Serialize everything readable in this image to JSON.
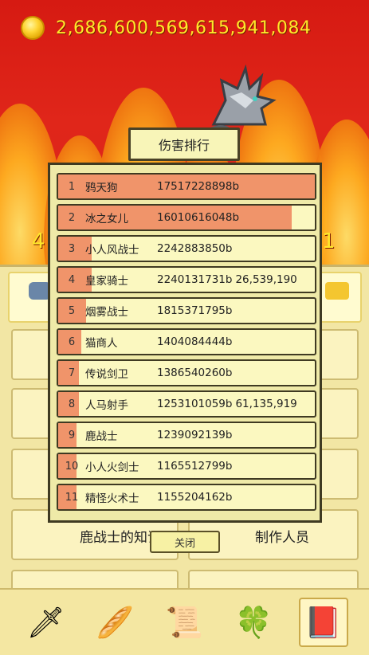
{
  "hud": {
    "coins": "2,686,600,569,615,941,084",
    "left_num": "4",
    "right_num": "1"
  },
  "dialog": {
    "title": "伤害排行",
    "close_label": "关闭",
    "rows": [
      {
        "rank": "1",
        "name": "鸦天狗",
        "damage": "17517228898b",
        "extra": "",
        "fill": 1.0
      },
      {
        "rank": "2",
        "name": "冰之女儿",
        "damage": "16010616048b",
        "extra": "",
        "fill": 0.91
      },
      {
        "rank": "3",
        "name": "小人风战士",
        "damage": "2242883850b",
        "extra": "",
        "fill": 0.13
      },
      {
        "rank": "4",
        "name": "皇家骑士",
        "damage": "2240131731b",
        "extra": "26,539,190",
        "fill": 0.13
      },
      {
        "rank": "5",
        "name": "烟雾战士",
        "damage": "1815371795b",
        "extra": "",
        "fill": 0.11
      },
      {
        "rank": "6",
        "name": "猫商人",
        "damage": "1404084444b",
        "extra": "",
        "fill": 0.09
      },
      {
        "rank": "7",
        "name": "传说剑卫",
        "damage": "1386540260b",
        "extra": "",
        "fill": 0.08
      },
      {
        "rank": "8",
        "name": "人马射手",
        "damage": "1253101059b",
        "extra": "61,135,919",
        "fill": 0.08
      },
      {
        "rank": "9",
        "name": "鹿战士",
        "damage": "1239092139b",
        "extra": "",
        "fill": 0.07
      },
      {
        "rank": "10",
        "name": "小人火剑士",
        "damage": "1165512799b",
        "extra": "",
        "fill": 0.07
      },
      {
        "rank": "11",
        "name": "精怪火术士",
        "damage": "1155204162b",
        "extra": "",
        "fill": 0.07
      }
    ]
  },
  "menu": {
    "item_knowledge": "鹿战士的知识",
    "item_credits": "制作人员"
  },
  "tabs": [
    {
      "name": "sword-icon",
      "glyph": "🗡"
    },
    {
      "name": "bread-icon",
      "glyph": "🥖"
    },
    {
      "name": "scroll-icon",
      "glyph": "📜"
    },
    {
      "name": "clover-icon",
      "glyph": "🍀"
    },
    {
      "name": "book-icon",
      "glyph": "📕"
    }
  ],
  "colors": {
    "bar_fill": "#f0946a",
    "coin_text": "#ffe82a",
    "background_red": "#d61a12"
  }
}
